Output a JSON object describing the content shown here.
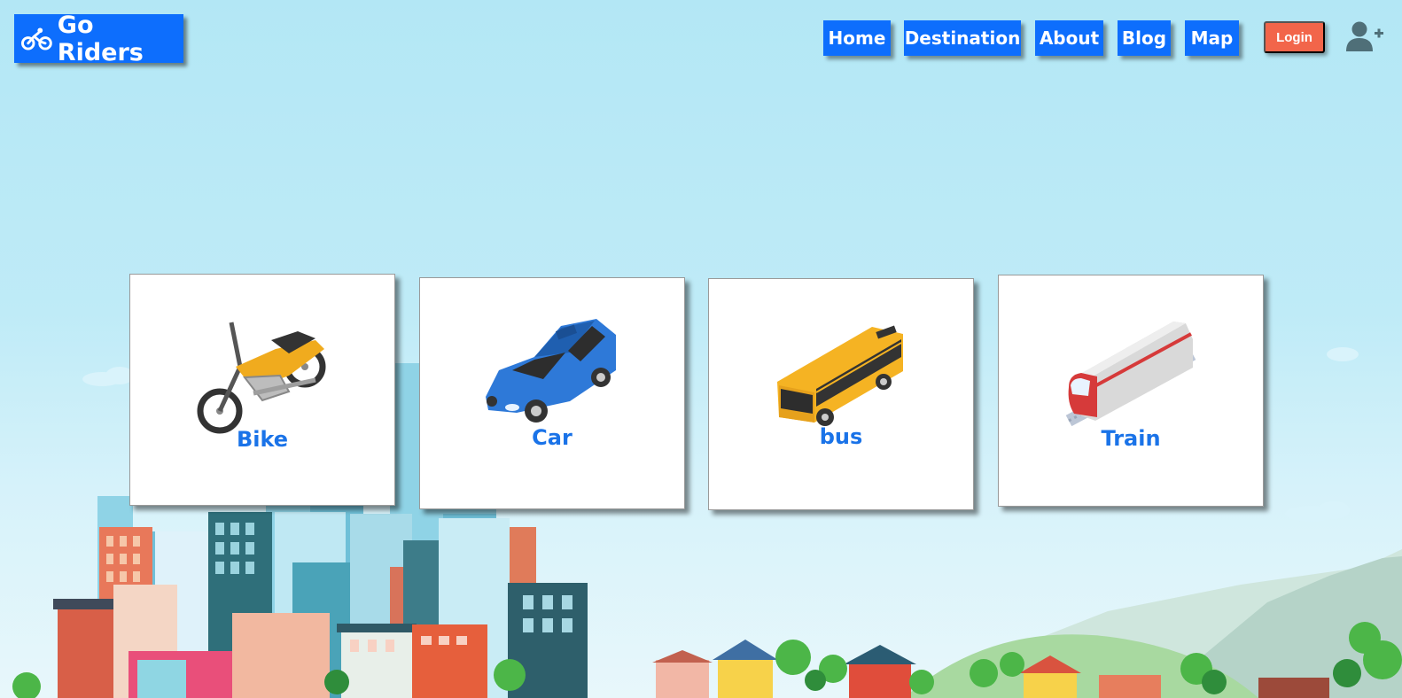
{
  "brand": {
    "name": "Go Riders",
    "icon": "bicycle-icon",
    "color": "#0d6efd"
  },
  "nav": {
    "items": [
      {
        "label": "Home"
      },
      {
        "label": "Destination"
      },
      {
        "label": "About"
      },
      {
        "label": "Blog"
      },
      {
        "label": "Map"
      }
    ],
    "login_label": "Login",
    "user_icon": "user-plus-icon",
    "login_color": "#f2654a"
  },
  "cards": [
    {
      "label": "Bike",
      "icon": "motorcycle-icon"
    },
    {
      "label": "Car",
      "icon": "car-icon"
    },
    {
      "label": "bus",
      "icon": "bus-icon"
    },
    {
      "label": "Train",
      "icon": "train-icon"
    }
  ],
  "colors": {
    "accent": "#0d6efd",
    "label": "#1a73e8",
    "sky": "#b3e7f5"
  }
}
